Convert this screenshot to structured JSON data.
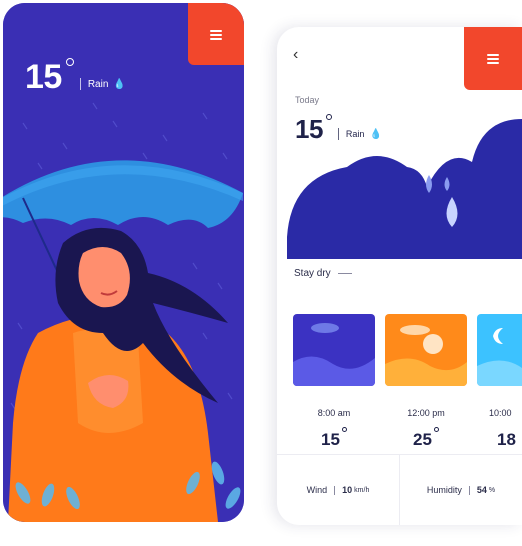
{
  "left_screen": {
    "temperature": "15",
    "condition": "Rain",
    "condition_icon": "raindrops-icon",
    "menu_icon": "hamburger-menu-icon",
    "background_color": "#3a2fb4",
    "accent_color": "#f2472c"
  },
  "right_screen": {
    "back_icon": "chevron-left-icon",
    "menu_icon": "hamburger-menu-icon",
    "day_label": "Today",
    "temperature": "15",
    "condition": "Rain",
    "section_label": "Stay dry",
    "forecast": [
      {
        "time": "8:00 am",
        "temp": "15",
        "icon": "night-clouds-icon"
      },
      {
        "time": "12:00 pm",
        "temp": "25",
        "icon": "sun-clouds-icon"
      },
      {
        "time": "10:00",
        "temp": "18",
        "icon": "moon-icon"
      }
    ],
    "wind": {
      "label": "Wind",
      "value": "10",
      "unit": "km/h"
    },
    "humidity": {
      "label": "Humidity",
      "value": "54",
      "unit": "%"
    }
  }
}
